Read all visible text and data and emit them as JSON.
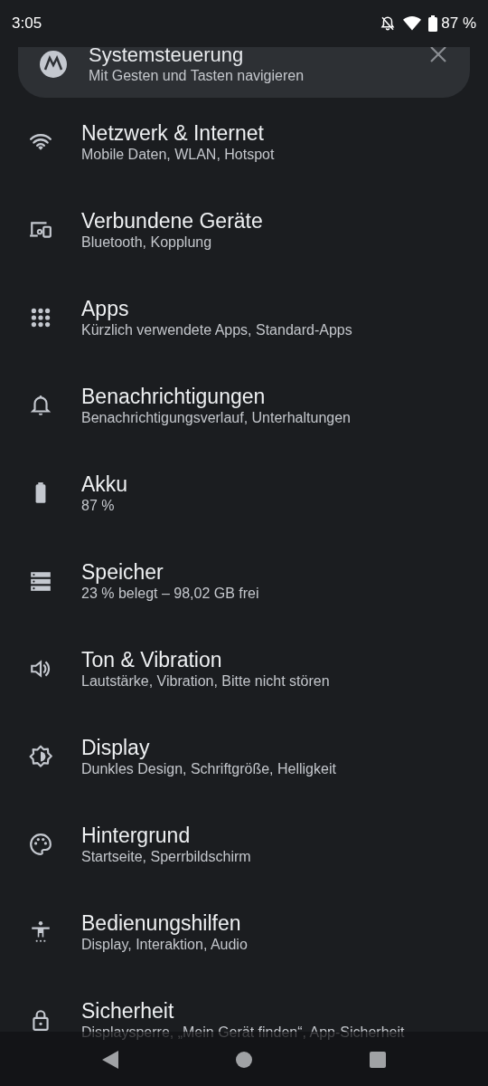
{
  "status_bar": {
    "time": "3:05",
    "battery": "87 %"
  },
  "suggestion_card": {
    "title": "Systemsteuerung",
    "subtitle": "Mit Gesten und Tasten navigieren"
  },
  "settings": [
    {
      "title": "Netzwerk & Internet",
      "subtitle": "Mobile Daten, WLAN, Hotspot"
    },
    {
      "title": "Verbundene Geräte",
      "subtitle": "Bluetooth, Kopplung"
    },
    {
      "title": "Apps",
      "subtitle": "Kürzlich verwendete Apps, Standard-Apps"
    },
    {
      "title": "Benachrichtigungen",
      "subtitle": "Benachrichtigungsverlauf, Unterhaltungen"
    },
    {
      "title": "Akku",
      "subtitle": "87 %"
    },
    {
      "title": "Speicher",
      "subtitle": "23 % belegt – 98,02 GB frei"
    },
    {
      "title": "Ton & Vibration",
      "subtitle": "Lautstärke, Vibration, Bitte nicht stören"
    },
    {
      "title": "Display",
      "subtitle": "Dunkles Design, Schriftgröße, Helligkeit"
    },
    {
      "title": "Hintergrund",
      "subtitle": "Startseite, Sperrbildschirm"
    },
    {
      "title": "Bedienungshilfen",
      "subtitle": "Display, Interaktion, Audio"
    },
    {
      "title": "Sicherheit",
      "subtitle": "Displaysperre, „Mein Gerät finden“, App-Sicherheit"
    }
  ]
}
